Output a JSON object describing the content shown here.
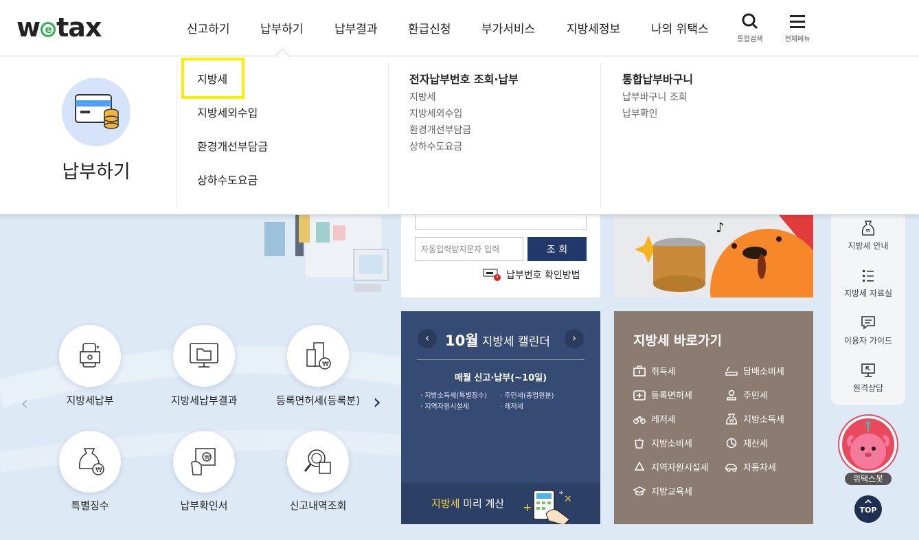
{
  "header": {
    "logo": {
      "w": "w",
      "e": "e",
      "rest": "tax"
    },
    "nav": [
      "신고하기",
      "납부하기",
      "납부결과",
      "환급신청",
      "부가서비스",
      "지방세정보",
      "나의 위택스"
    ],
    "search_label": "통합검색",
    "menu_label": "전체메뉴"
  },
  "dropdown": {
    "title": "납부하기",
    "primary": [
      "지방세",
      "지방세외수입",
      "환경개선부담금",
      "상하수도요금"
    ],
    "groups": [
      {
        "title": "전자납부번호 조회·납부",
        "items": [
          "지방세",
          "지방세외수입",
          "환경개선부담금",
          "상하수도요금"
        ]
      },
      {
        "title": "통합납부바구니",
        "items": [
          "납부바구니 조회",
          "납부확인"
        ]
      }
    ]
  },
  "search_panel": {
    "captcha_placeholder": "자동입력방지문자 입력",
    "check_button": "조 회",
    "howto": "납부번호 확인방법"
  },
  "calendar": {
    "month": "10월",
    "title": "지방세 캘린더",
    "heading": "매월 신고·납부(~10일)",
    "items": [
      "지방소득세(특별징수)",
      "주민세(종업원분)",
      "지역자원시설세",
      "레저세"
    ],
    "calc_highlight": "지방세",
    "calc_rest": " 미리 계산"
  },
  "shortcut": {
    "title": "지방세 바로가기",
    "items": [
      "취득세",
      "담배소비세",
      "등록면허세",
      "주민세",
      "레저세",
      "지방소득세",
      "지방소비세",
      "재산세",
      "지역자원시설세",
      "자동차세",
      "지방교육세"
    ]
  },
  "quick_menu": [
    "지방세납부",
    "지방세납부결과",
    "등록면허세(등록분)",
    "특별징수",
    "납부확인서",
    "신고내역조회"
  ],
  "sidebar": [
    "지방세 안내",
    "지방세 자료실",
    "이용자 가이드",
    "원격상담"
  ],
  "bot_label": "위택스봇",
  "top_label": "TOP",
  "colors": {
    "navy": "#22386a",
    "highlight": "#ffee00",
    "calendar_bg": "#364b73",
    "shortcut_bg": "#8b7b71",
    "accent_yellow": "#f7d23a"
  }
}
